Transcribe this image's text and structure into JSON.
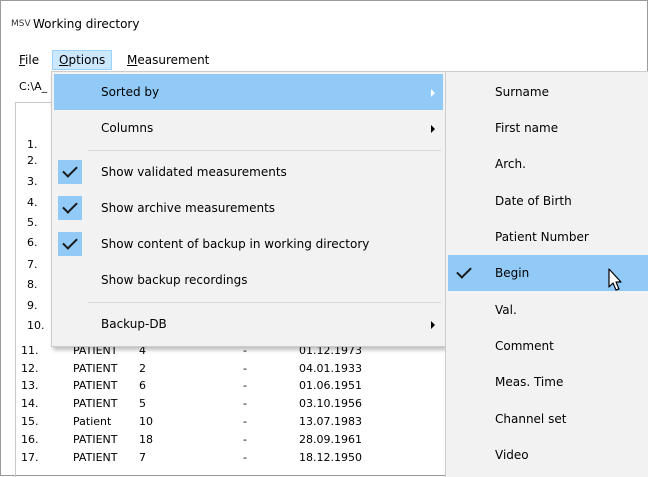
{
  "window": {
    "title": "Working directory",
    "icon_text": "MSV",
    "icon_name": "msv-app-icon"
  },
  "menubar": [
    {
      "label": "File",
      "underline": "F",
      "rest": "ile",
      "active": false
    },
    {
      "label": "Options",
      "underline": "O",
      "rest": "ptions",
      "active": true
    },
    {
      "label": "Measurement",
      "underline": "M",
      "rest": "easurement",
      "active": false
    }
  ],
  "path_text": "C:\\A_",
  "list": {
    "hidden_numbers": [
      "1.",
      "2.",
      "3.",
      "4.",
      "5.",
      "6.",
      "7.",
      "8.",
      "9.",
      "10."
    ],
    "rows": [
      {
        "num": "11.",
        "name": "PATIENT",
        "id": "4",
        "val": "-",
        "date": "01.12.1973"
      },
      {
        "num": "12.",
        "name": "PATIENT",
        "id": "2",
        "val": "-",
        "date": "04.01.1933"
      },
      {
        "num": "13.",
        "name": "PATIENT",
        "id": "6",
        "val": "-",
        "date": "01.06.1951"
      },
      {
        "num": "14.",
        "name": "PATIENT",
        "id": "5",
        "val": "-",
        "date": "03.10.1956"
      },
      {
        "num": "15.",
        "name": "Patient",
        "id": "10",
        "val": "-",
        "date": "13.07.1983"
      },
      {
        "num": "16.",
        "name": "PATIENT",
        "id": "18",
        "val": "-",
        "date": "28.09.1961"
      },
      {
        "num": "17.",
        "name": "PATIENT",
        "id": "7",
        "val": "-",
        "date": "18.12.1950"
      }
    ]
  },
  "options_menu": {
    "items": [
      {
        "label": "Sorted by",
        "checked": false,
        "submenu": true,
        "highlighted": true
      },
      {
        "label": "Columns",
        "checked": false,
        "submenu": true,
        "highlighted": false
      },
      {
        "label": "Show validated measurements",
        "checked": true,
        "submenu": false,
        "highlighted": false
      },
      {
        "label": "Show archive measurements",
        "checked": true,
        "submenu": false,
        "highlighted": false
      },
      {
        "label": "Show content of backup in working directory",
        "checked": true,
        "submenu": false,
        "highlighted": false
      },
      {
        "label": "Show backup recordings",
        "checked": false,
        "submenu": false,
        "highlighted": false
      },
      {
        "label": "Backup-DB",
        "checked": false,
        "submenu": true,
        "highlighted": false
      }
    ]
  },
  "sort_submenu": {
    "items": [
      {
        "label": "Surname",
        "checked": false
      },
      {
        "label": "First name",
        "checked": false
      },
      {
        "label": "Arch.",
        "checked": false
      },
      {
        "label": "Date of Birth",
        "checked": false
      },
      {
        "label": "Patient Number",
        "checked": false
      },
      {
        "label": "Begin",
        "checked": true
      },
      {
        "label": "Val.",
        "checked": false
      },
      {
        "label": "Comment",
        "checked": false
      },
      {
        "label": "Meas. Time",
        "checked": false
      },
      {
        "label": "Channel set",
        "checked": false
      },
      {
        "label": "Video",
        "checked": false
      }
    ]
  },
  "colors": {
    "highlight": "#91c9f7",
    "menu_bg": "#f2f2f2",
    "menubar_active": "#cce8ff"
  }
}
